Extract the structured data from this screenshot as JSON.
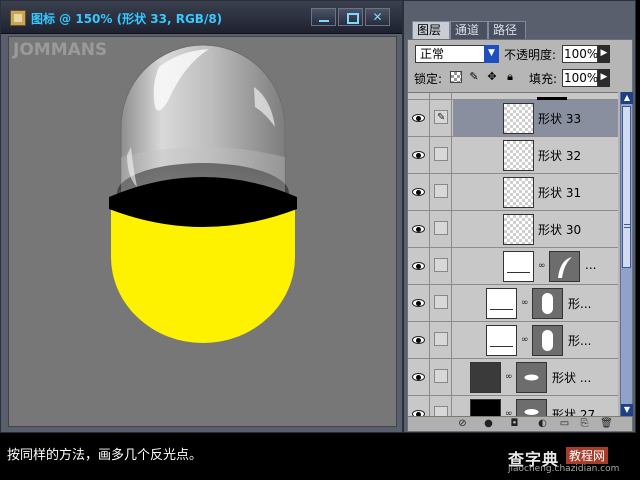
{
  "document": {
    "title": "图标 @ 150% (形状 33, RGB/8)",
    "watermark": "JOMMANS",
    "minimize_icon": "minimize-icon",
    "restore_icon": "restore-icon",
    "close_label": "✕",
    "capsule_colors": {
      "body": "#fff200",
      "band": "#000000",
      "glass": "#cfcfcf"
    }
  },
  "layers_panel": {
    "tabs": [
      {
        "label": "图层",
        "active": true
      },
      {
        "label": "通道",
        "active": false
      },
      {
        "label": "路径",
        "active": false
      }
    ],
    "blend_mode": "正常",
    "opacity_label": "不透明度:",
    "opacity_value": "100%",
    "lock_label": "锁定:",
    "fill_label": "填充:",
    "fill_value": "100%",
    "layers": [
      {
        "name": "形状 33",
        "selected": true,
        "visible": true,
        "thumb": "checker"
      },
      {
        "name": "形状 32",
        "selected": false,
        "visible": true,
        "thumb": "checker"
      },
      {
        "name": "形状 31",
        "selected": false,
        "visible": true,
        "thumb": "checker"
      },
      {
        "name": "形状 30",
        "selected": false,
        "visible": true,
        "thumb": "checker"
      },
      {
        "name": "...",
        "selected": false,
        "visible": true,
        "thumb": "white"
      },
      {
        "name": "形...",
        "selected": false,
        "visible": true,
        "thumb": "white"
      },
      {
        "name": "形...",
        "selected": false,
        "visible": true,
        "thumb": "white"
      },
      {
        "name": "形状 ...",
        "selected": false,
        "visible": true,
        "thumb": "dark"
      },
      {
        "name": "形状 27",
        "selected": false,
        "visible": true,
        "thumb": "black"
      }
    ],
    "footer_icons": [
      "link-layers-icon",
      "layer-style-icon",
      "layer-mask-icon",
      "new-group-icon",
      "adjustment-layer-icon",
      "new-layer-icon",
      "delete-layer-icon"
    ]
  },
  "caption": "按同样的方法，画多几个反光点。",
  "site": {
    "name": "查字典",
    "tag": "教程网",
    "url": "jiaocheng.chazidian.com"
  }
}
